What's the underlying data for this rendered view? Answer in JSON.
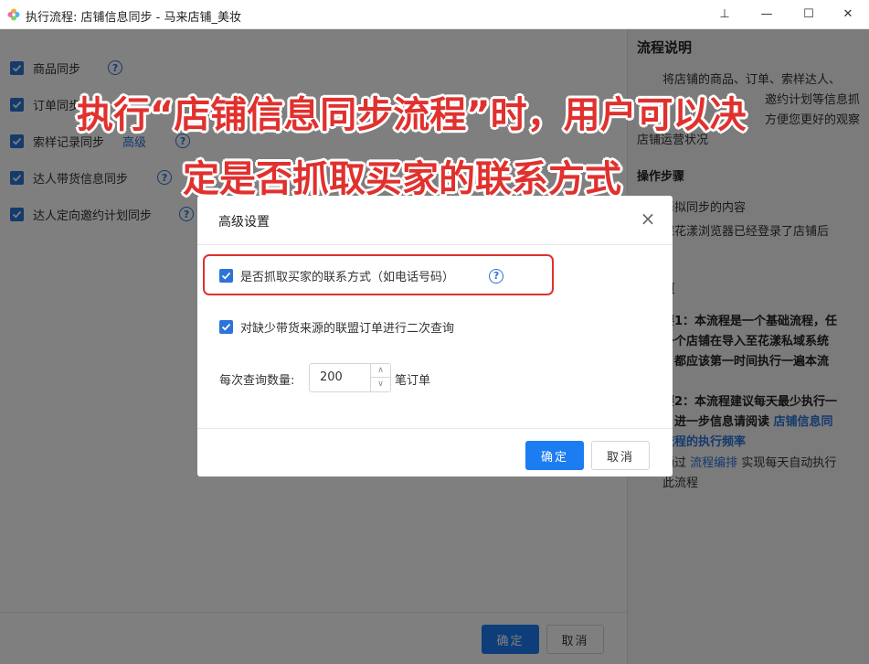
{
  "window": {
    "title": "执行流程: 店铺信息同步 - 马来店铺_美妆",
    "controls": {
      "pin": "⊥",
      "minimize": "—",
      "maximize": "☐",
      "close": "✕"
    }
  },
  "options": [
    {
      "label": "商品同步",
      "checked": true
    },
    {
      "label": "订单同步",
      "checked": true
    },
    {
      "label": "索样记录同步",
      "link": "高级",
      "checked": true
    },
    {
      "label": "达人带货信息同步",
      "checked": true
    },
    {
      "label": "达人定向邀约计划同步",
      "checked": true
    }
  ],
  "footer": {
    "confirm_label": "确定",
    "cancel_label": "取消"
  },
  "sidebar": {
    "title": "流程说明",
    "intro_lines": [
      "将店铺的商品、订单、索样达人、",
      "邀约计划等信息抓",
      "方便您更好的观察",
      "店铺运营状况"
    ],
    "steps_title": "操作步骤",
    "steps_lines": [
      "择拟同步的内容",
      "保花漾浏览器已经登录了店铺后"
    ],
    "notes_title": "项",
    "note1_lines": [
      "要1：本流程是一个基础流程，任",
      "一个店铺在导入至花漾私域系统",
      "，都应该第一时间执行一遍本流"
    ],
    "note2_lines": [
      "要2：本流程建议每天最少执行一",
      "，进一步信息请阅读"
    ],
    "note2_link1": "店铺信息同",
    "note2_link2": "流程的执行频率",
    "note3_prefix": "通过",
    "note3_link": "流程编排",
    "note3_suffix": "实现每天自动执行",
    "note3_end": "此流程"
  },
  "modal": {
    "title": "高级设置",
    "close": "×",
    "option1_label": "是否抓取买家的联系方式（如电话号码）",
    "option2_label": "对缺少带货来源的联盟订单进行二次查询",
    "qty_label": "每次查询数量:",
    "qty_value": "200",
    "qty_unit": "笔订单",
    "confirm_label": "确定",
    "cancel_label": "取消"
  },
  "caption": {
    "line1": "执行“店铺信息同步流程”时，用户可以决",
    "line2": "定是否抓取买家的联系方式"
  },
  "colors": {
    "accent": "#1c7cf2",
    "highlight": "#e0312e"
  }
}
